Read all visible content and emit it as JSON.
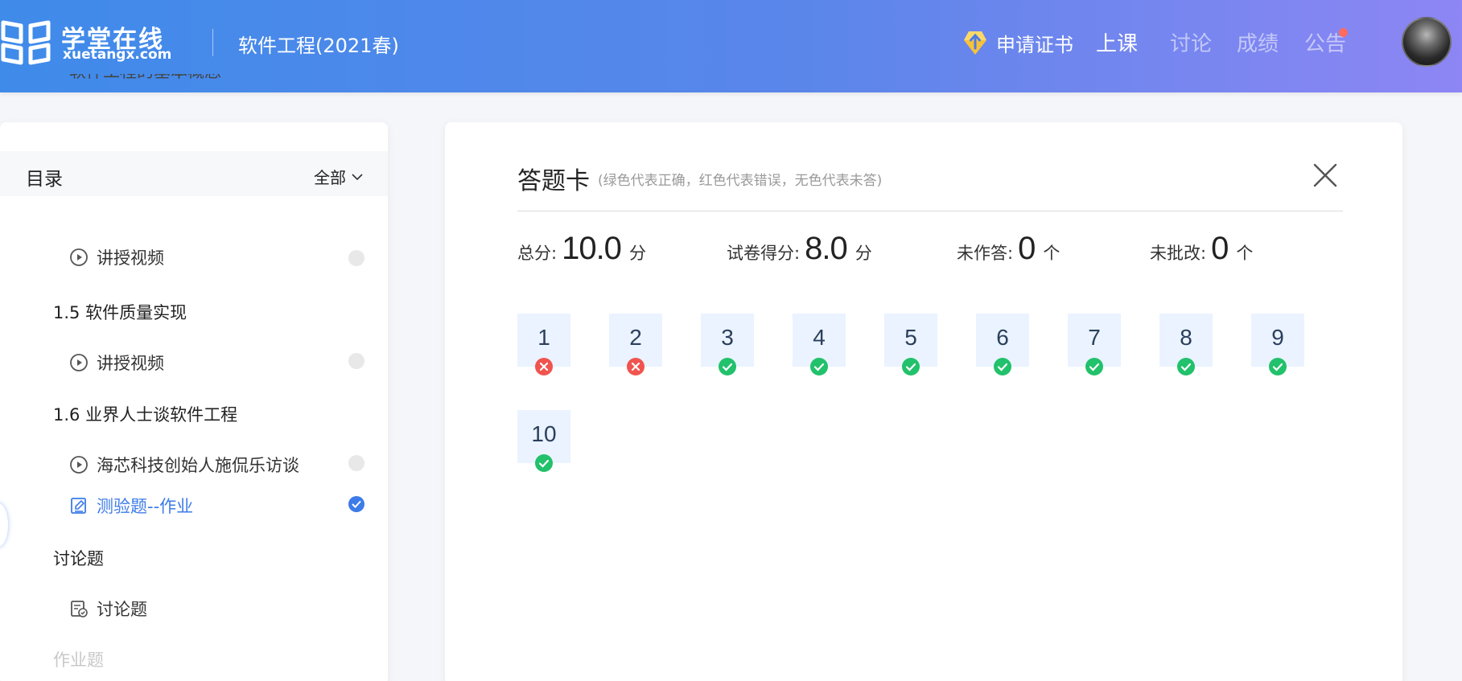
{
  "header": {
    "logo_cn": "学堂在线",
    "logo_en": "xuetangx.com",
    "course_title": "软件工程(2021春)",
    "certificate_label": "申请证书",
    "nav": [
      {
        "label": "上课",
        "active": true
      },
      {
        "label": "讨论",
        "active": false
      },
      {
        "label": "成绩",
        "active": false
      },
      {
        "label": "公告",
        "active": false,
        "has_notification": true
      }
    ]
  },
  "sidebar": {
    "title": "目录",
    "filter_label": "全部",
    "partial_top_text": "软件工程的基本概念",
    "entries": [
      {
        "type": "video",
        "label": "讲授视频",
        "status": "unwatched"
      },
      {
        "type": "section",
        "label": "1.5 软件质量实现"
      },
      {
        "type": "video",
        "label": "讲授视频",
        "status": "unwatched"
      },
      {
        "type": "section",
        "label": "1.6 业界人士谈软件工程"
      },
      {
        "type": "video",
        "label": "海芯科技创始人施侃乐访谈",
        "status": "unwatched"
      },
      {
        "type": "quiz",
        "label": "测验题--作业",
        "status": "completed",
        "active": true
      },
      {
        "type": "section",
        "label": "讨论题"
      },
      {
        "type": "discussion",
        "label": "讨论题"
      }
    ],
    "faded_bottom_text": "作业题"
  },
  "answer_card": {
    "title": "答题卡",
    "note": "(绿色代表正确，红色代表错误，无色代表未答)",
    "stats": [
      {
        "label": "总分:",
        "value": "10.0",
        "unit": "分"
      },
      {
        "label": "试卷得分:",
        "value": "8.0",
        "unit": "分"
      },
      {
        "label": "未作答:",
        "value": "0",
        "unit": "个"
      },
      {
        "label": "未批改:",
        "value": "0",
        "unit": "个"
      }
    ],
    "questions": [
      {
        "number": "1",
        "result": "wrong"
      },
      {
        "number": "2",
        "result": "wrong"
      },
      {
        "number": "3",
        "result": "correct"
      },
      {
        "number": "4",
        "result": "correct"
      },
      {
        "number": "5",
        "result": "correct"
      },
      {
        "number": "6",
        "result": "correct"
      },
      {
        "number": "7",
        "result": "correct"
      },
      {
        "number": "8",
        "result": "correct"
      },
      {
        "number": "9",
        "result": "correct"
      },
      {
        "number": "10",
        "result": "correct"
      }
    ]
  },
  "colors": {
    "correct": "#22c16b",
    "wrong": "#f0544f",
    "accent": "#3d7be8",
    "question_bg": "#eaf3ff"
  },
  "icons": {
    "logo": "xuetangx-logo-icon",
    "certificate": "diamond-icon",
    "close": "close-icon",
    "video": "play-circle-icon",
    "quiz": "edit-doc-icon",
    "discussion": "discussion-doc-icon"
  }
}
